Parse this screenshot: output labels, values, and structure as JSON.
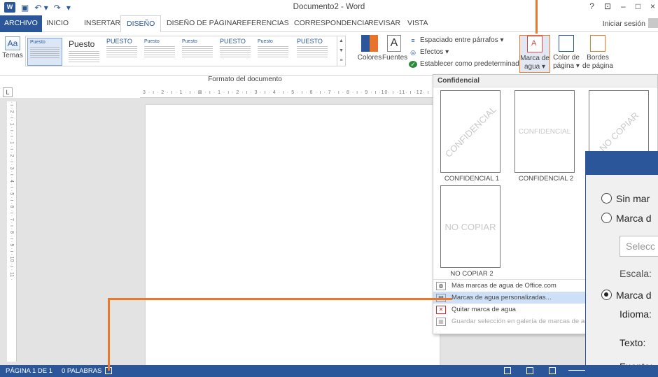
{
  "titlebar": {
    "title": "Documento2 - Word",
    "win_help": "?",
    "win_restore": "⊡",
    "win_min": "–",
    "win_max": "□",
    "win_close": "×"
  },
  "tabs": [
    "ARCHIVO",
    "INICIO",
    "INSERTAR",
    "DISEÑO",
    "DISEÑO DE PÁGINA",
    "REFERENCIAS",
    "CORRESPONDENCIA",
    "REVISAR",
    "VISTA"
  ],
  "signin": "Iniciar sesión",
  "ribbon": {
    "themes_label": "Temas",
    "themes_icon_text": "Aa",
    "styles": [
      {
        "title": "Puesto",
        "big": false
      },
      {
        "title": "Puesto",
        "big": true
      },
      {
        "title": "PUESTO",
        "big": false
      },
      {
        "title": "Puesto",
        "big": false
      },
      {
        "title": "Puesto",
        "big": false
      },
      {
        "title": "PUESTO",
        "big": false
      },
      {
        "title": "Puesto",
        "big": false
      },
      {
        "title": "PUESTO",
        "big": false
      }
    ],
    "colors_label": "Colores",
    "fonts_label": "Fuentes",
    "fonts_icon_text": "A",
    "spacing_label": "Espaciado entre párrafos ▾",
    "effects_label": "Efectos ▾",
    "set_default_label": "Establecer como predeterminada",
    "watermark_label_1": "Marca de",
    "watermark_label_2": "agua ▾",
    "pagecolor_label_1": "Color de",
    "pagecolor_label_2": "página ▾",
    "borders_label_1": "Bordes",
    "borders_label_2": "de página",
    "group_label": "Formato del documento"
  },
  "rulers": {
    "top": "3 · ı · 2 · ı · 1 · ı · ⊠ · ı · 1 · ı · 2 · ı · 3 · ı · 4 · ı · 5 · ı · 6 · ı · 7 · ı · 8 · ı · 9 · ı ·10· ı ·11· ı ·12· ı",
    "left": "· ı · 2 · ı · 1 · ı · ı · 1 · ı · 2 · ı · 3 · ı · 4 · ı · 5 · ı · 6 · ı · 7 · ı · 8 · ı · 9 · ı · 10 · ı · 11 ·",
    "tab_selector": "L"
  },
  "dropdown": {
    "header": "Confidencial",
    "items": [
      {
        "text": "CONFIDENCIAL",
        "caption": "CONFIDENCIAL 1"
      },
      {
        "text": "CONFIDENCIAL",
        "caption": "CONFIDENCIAL 2"
      },
      {
        "text": "NO COPIAR",
        "caption": ""
      },
      {
        "text": "NO COPIAR",
        "caption": "NO COPIAR 2"
      }
    ],
    "menu": [
      {
        "label": "Más marcas de agua de Office.com"
      },
      {
        "label": "Marcas de agua personalizadas..."
      },
      {
        "label": "Quitar marca de agua"
      },
      {
        "label": "Guardar selección en galería de marcas de agua..."
      }
    ]
  },
  "dialog": {
    "no_watermark": "Sin mar",
    "picture_watermark": "Marca d",
    "select_button": "Selecc",
    "scale_label": "Escala:",
    "text_watermark": "Marca d",
    "language_label": "Idioma:",
    "text_label": "Texto:",
    "font_label": "Fuente:"
  },
  "statusbar": {
    "page": "PÁGINA 1 DE 1",
    "words": "0 PALABRAS"
  }
}
